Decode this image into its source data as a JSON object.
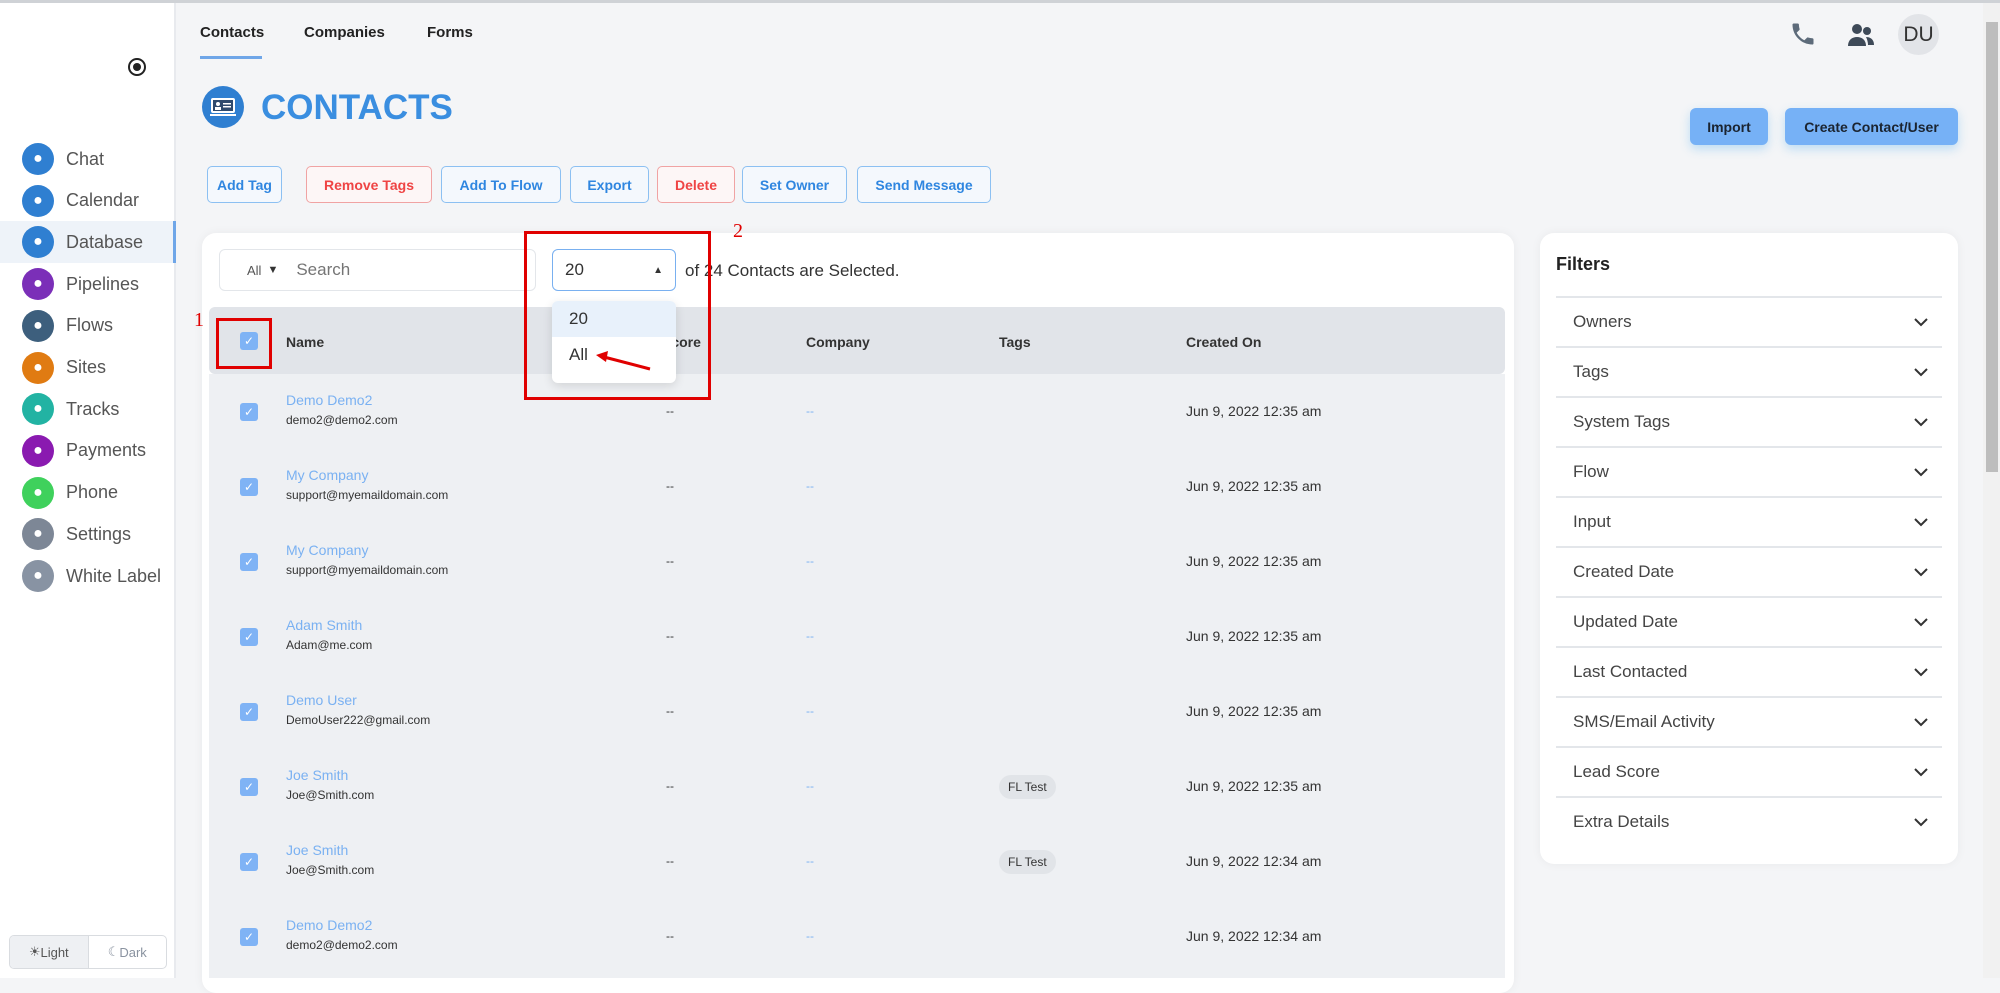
{
  "sidebar": {
    "items": [
      {
        "label": "Chat",
        "icon": "chat-icon",
        "color": "#2f7fd1"
      },
      {
        "label": "Calendar",
        "icon": "calendar-icon",
        "color": "#2f7fd1"
      },
      {
        "label": "Database",
        "icon": "database-icon",
        "color": "#2f7fd1",
        "active": true
      },
      {
        "label": "Pipelines",
        "icon": "pipelines-icon",
        "color": "#7b2fb8"
      },
      {
        "label": "Flows",
        "icon": "flows-icon",
        "color": "#3d5f7d"
      },
      {
        "label": "Sites",
        "icon": "lightbulb-icon",
        "color": "#e07b12"
      },
      {
        "label": "Tracks",
        "icon": "tracks-icon",
        "color": "#22b3a3"
      },
      {
        "label": "Payments",
        "icon": "payments-icon",
        "color": "#8a1ab0"
      },
      {
        "label": "Phone",
        "icon": "phone-icon",
        "color": "#3fd15c"
      },
      {
        "label": "Settings",
        "icon": "settings-icon",
        "color": "#7d8796"
      },
      {
        "label": "White Label",
        "icon": "palette-icon",
        "color": "#8893a3"
      }
    ],
    "theme": {
      "light": "Light",
      "dark": "Dark"
    }
  },
  "tabs": [
    "Contacts",
    "Companies",
    "Forms"
  ],
  "header": {
    "avatar": "DU",
    "title": "CONTACTS"
  },
  "actions": {
    "add_tag": "Add Tag",
    "remove_tags": "Remove Tags",
    "add_to_flow": "Add To Flow",
    "export": "Export",
    "delete": "Delete",
    "set_owner": "Set Owner",
    "send_message": "Send Message",
    "import": "Import",
    "create": "Create Contact/User"
  },
  "search": {
    "scope": "All",
    "placeholder": "Search"
  },
  "page_size": {
    "value": "20",
    "options": [
      "20",
      "All"
    ],
    "selected_text": "of 24 Contacts are Selected."
  },
  "table": {
    "columns": [
      "Name",
      "Score",
      "Company",
      "Tags",
      "Created On"
    ],
    "rows": [
      {
        "name": "Demo Demo2",
        "email": "demo2@demo2.com",
        "score": "--",
        "company": "--",
        "tag": "",
        "created": "Jun 9, 2022 12:35 am"
      },
      {
        "name": "My Company",
        "email": "support@myemaildomain.com",
        "score": "--",
        "company": "--",
        "tag": "",
        "created": "Jun 9, 2022 12:35 am"
      },
      {
        "name": "My Company",
        "email": "support@myemaildomain.com",
        "score": "--",
        "company": "--",
        "tag": "",
        "created": "Jun 9, 2022 12:35 am"
      },
      {
        "name": "Adam Smith",
        "email": "Adam@me.com",
        "score": "--",
        "company": "--",
        "tag": "",
        "created": "Jun 9, 2022 12:35 am"
      },
      {
        "name": "Demo User",
        "email": "DemoUser222@gmail.com",
        "score": "--",
        "company": "--",
        "tag": "",
        "created": "Jun 9, 2022 12:35 am"
      },
      {
        "name": "Joe Smith",
        "email": "Joe@Smith.com",
        "score": "--",
        "company": "--",
        "tag": "FL Test",
        "created": "Jun 9, 2022 12:35 am"
      },
      {
        "name": "Joe Smith",
        "email": "Joe@Smith.com",
        "score": "--",
        "company": "--",
        "tag": "FL Test",
        "created": "Jun 9, 2022 12:34 am"
      },
      {
        "name": "Demo Demo2",
        "email": "demo2@demo2.com",
        "score": "--",
        "company": "--",
        "tag": "",
        "created": "Jun 9, 2022 12:34 am"
      }
    ]
  },
  "filters": {
    "title": "Filters",
    "items": [
      "Owners",
      "Tags",
      "System Tags",
      "Flow",
      "Input",
      "Created Date",
      "Updated Date",
      "Last Contacted",
      "SMS/Email Activity",
      "Lead Score",
      "Extra Details"
    ]
  },
  "annotations": {
    "one": "1",
    "two": "2"
  }
}
